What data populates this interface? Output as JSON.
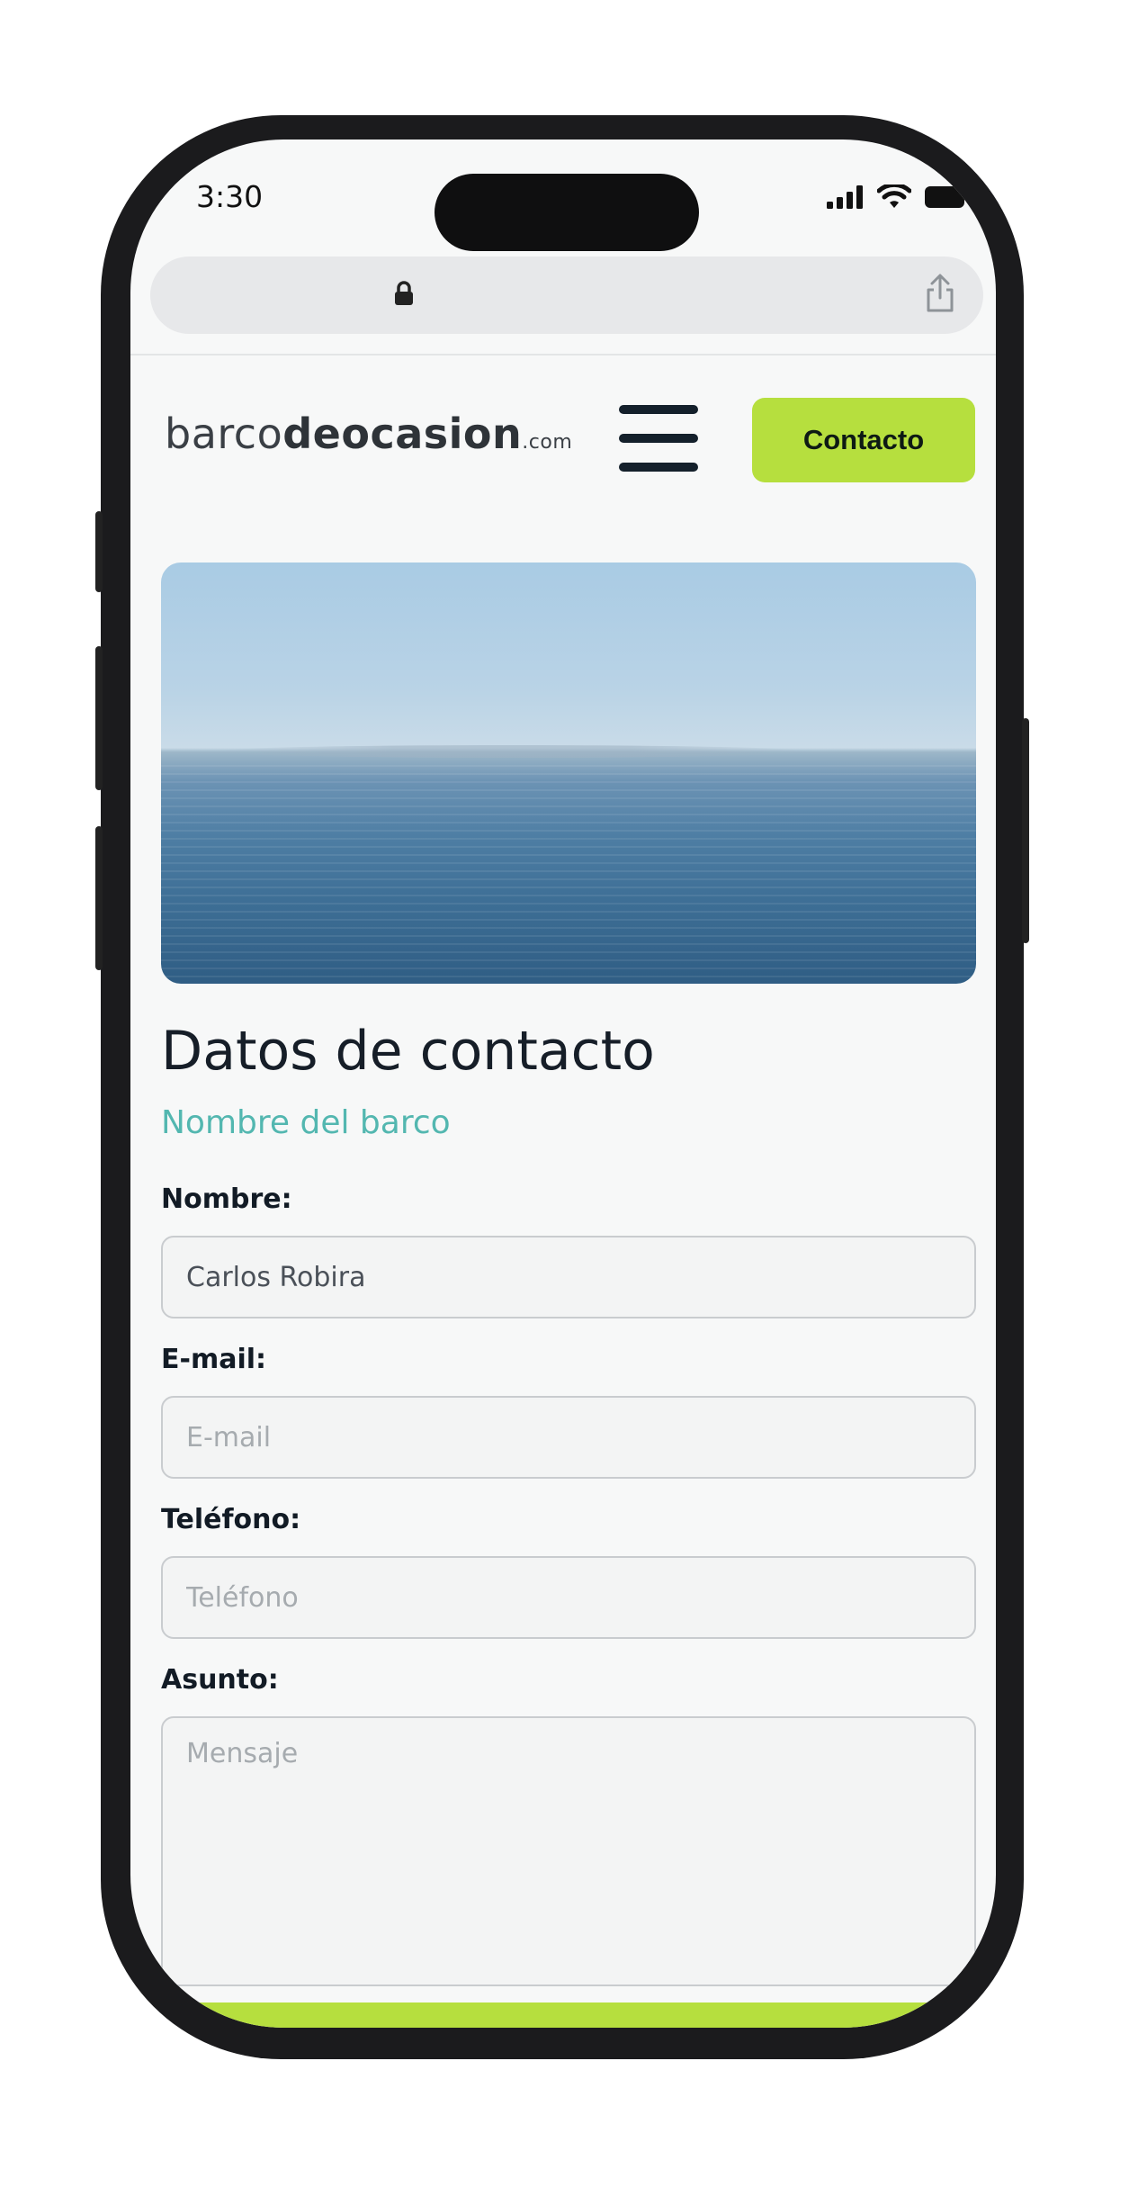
{
  "status_bar": {
    "time": "3:30"
  },
  "logo": {
    "part1": "barco",
    "part2": "de",
    "part3": "ocasion",
    "suffix": ".com"
  },
  "header": {
    "contact_button": "Contacto"
  },
  "page": {
    "title": "Datos de contacto",
    "subtitle": "Nombre del barco"
  },
  "form": {
    "name_label": "Nombre:",
    "name_value": "Carlos Robira",
    "email_label": "E-mail:",
    "email_placeholder": "E-mail",
    "phone_label": "Teléfono:",
    "phone_placeholder": "Teléfono",
    "subject_label": "Asunto:",
    "message_placeholder": "Mensaje"
  },
  "colors": {
    "accent": "#b6df3e",
    "subtitle": "#53b7b0",
    "text": "#161e28"
  },
  "icons": [
    "lock-icon",
    "share-icon",
    "signal-icon",
    "wifi-icon",
    "battery-icon",
    "hamburger-menu-icon"
  ]
}
